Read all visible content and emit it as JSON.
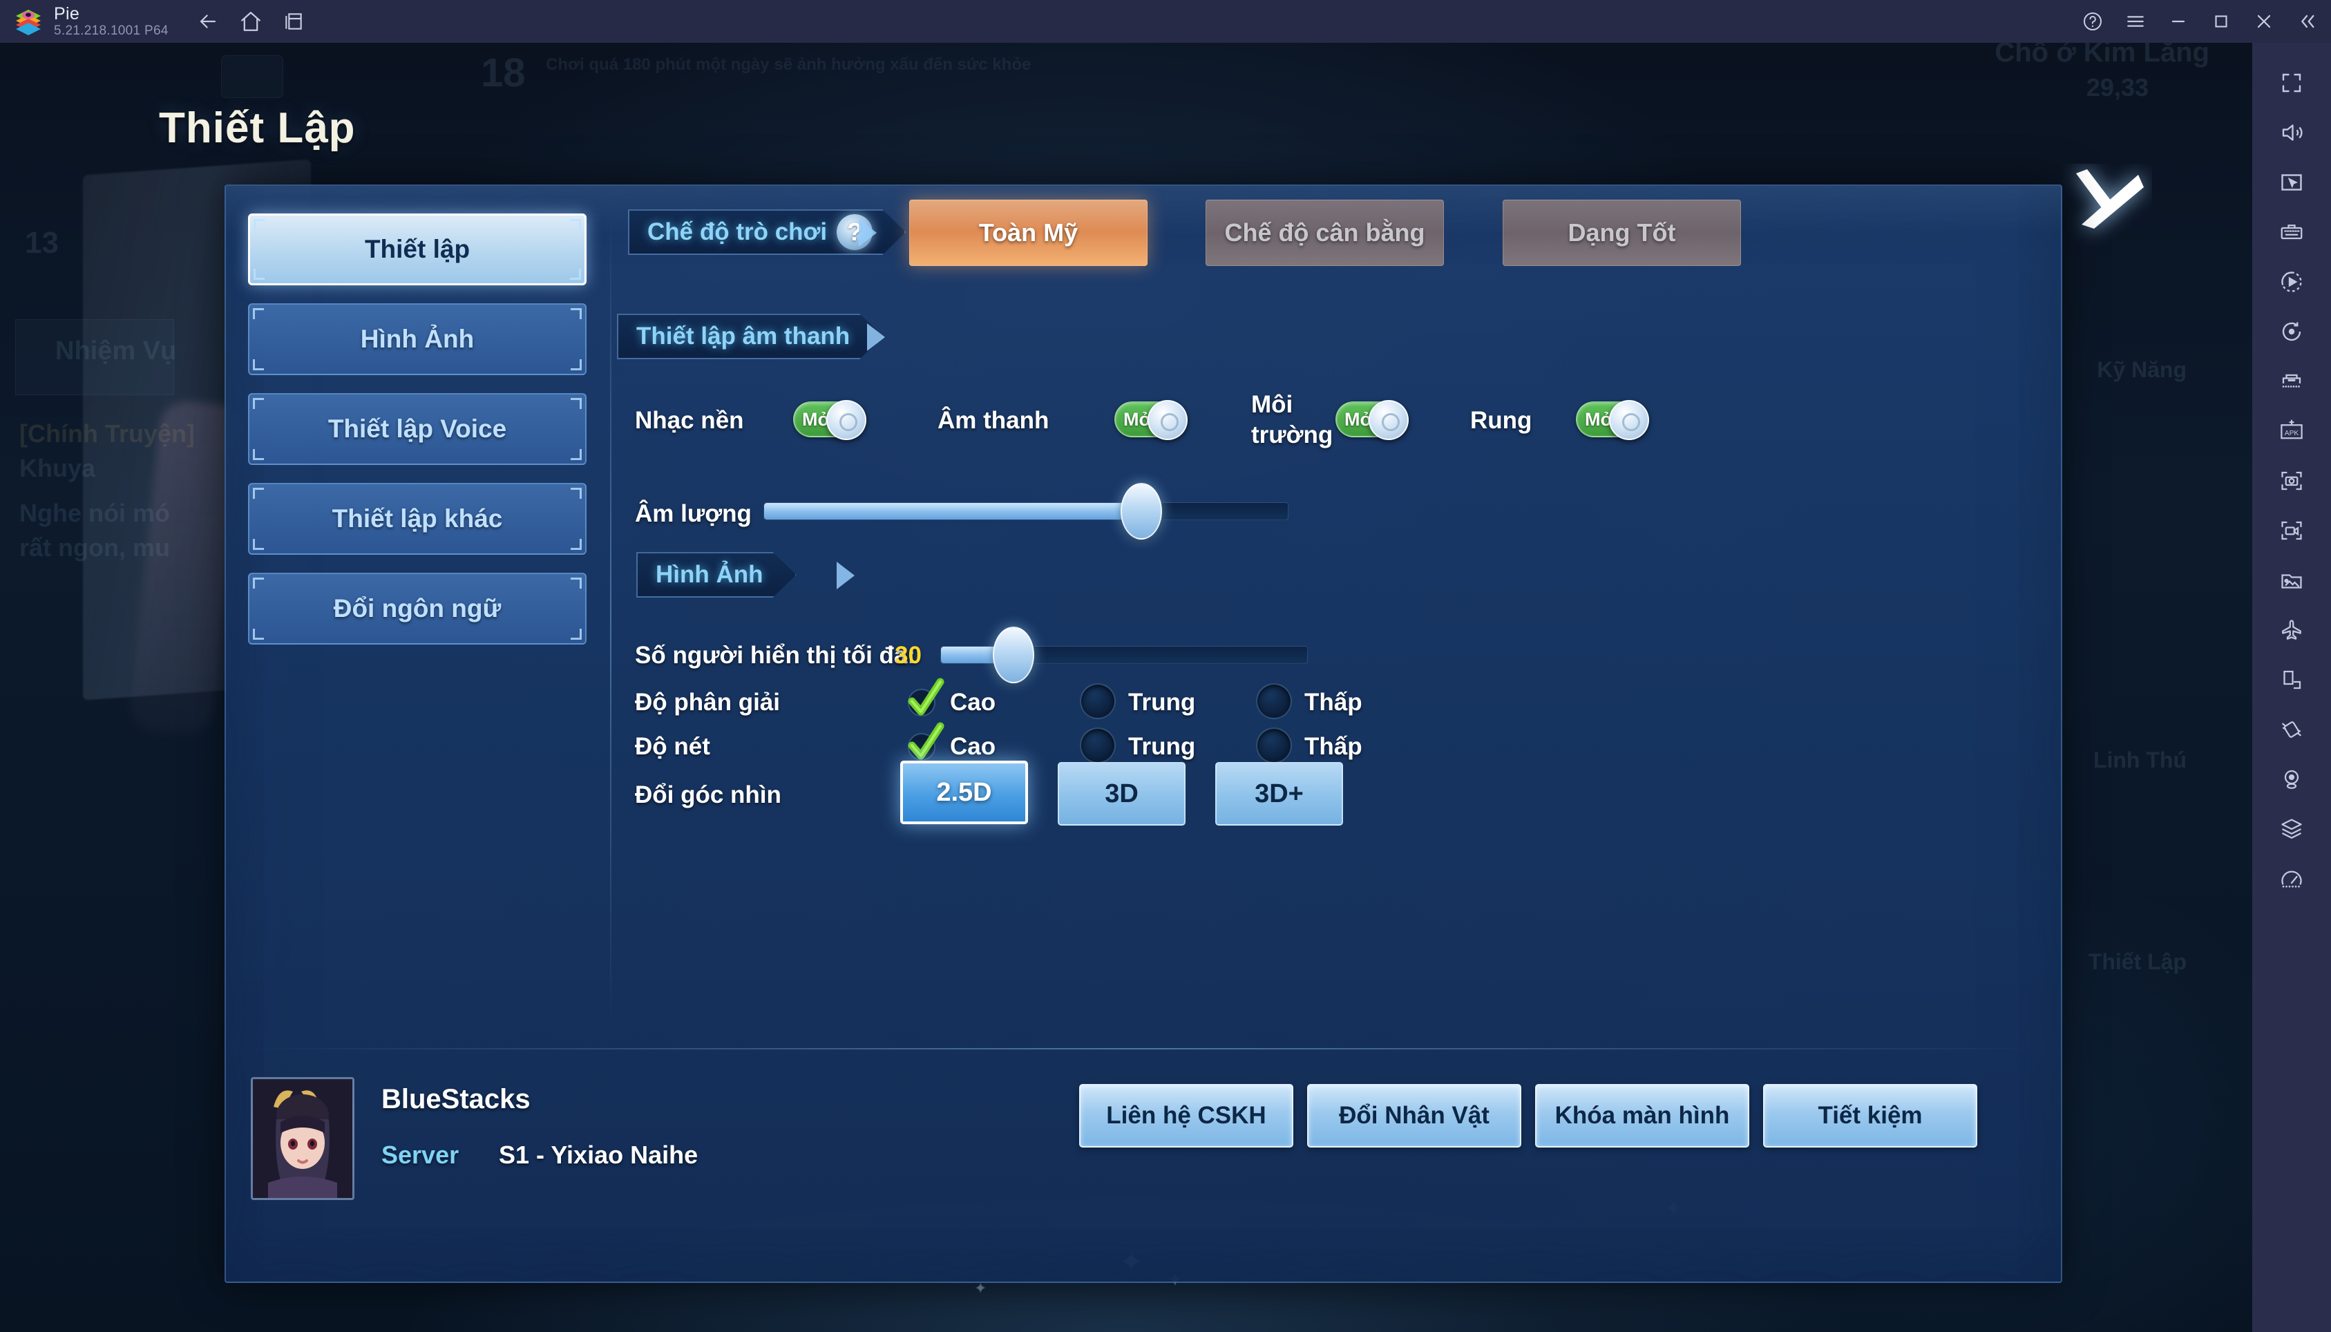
{
  "titlebar": {
    "app_name": "Pie",
    "version": "5.21.218.1001  P64",
    "nav": [
      {
        "name": "back-icon",
        "label": "Back"
      },
      {
        "name": "home-icon",
        "label": "Home"
      },
      {
        "name": "multi-instance-icon",
        "label": "Multi-instance"
      }
    ],
    "right": [
      {
        "name": "help-icon",
        "label": "Help"
      },
      {
        "name": "menu-icon",
        "label": "Menu"
      },
      {
        "name": "minimize-icon",
        "label": "Minimize"
      },
      {
        "name": "maximize-icon",
        "label": "Maximize"
      },
      {
        "name": "close-icon",
        "label": "Close"
      },
      {
        "name": "collapse-rail-icon",
        "label": "Collapse"
      }
    ]
  },
  "background": {
    "level": "13",
    "quest_panel_title": "Nhiệm Vụ",
    "quest_line1": "[Chính Truyện]",
    "quest_line2": "Khuya",
    "quest_line3": "Nghe nói mó",
    "quest_line4": "rất ngon, mu",
    "location": "Chỗ ở Kim Lăng",
    "coords": "29,33",
    "age_rating": "18",
    "health_notice": "Chơi quá 180 phút một ngày sẽ ảnh hưởng xấu đến sức khỏe",
    "right_label_1": "Kỹ Năng",
    "right_label_2": "Linh Thú",
    "right_label_3": "Thiết Lập"
  },
  "page_title": "Thiết Lập",
  "close_button": {
    "name": "close-dialog",
    "label": "X"
  },
  "sidebar": {
    "items": [
      {
        "label": "Thiết lập",
        "active": true
      },
      {
        "label": "Hình Ảnh",
        "active": false
      },
      {
        "label": "Thiết lập Voice",
        "active": false
      },
      {
        "label": "Thiết lập khác",
        "active": false
      },
      {
        "label": "Đổi ngôn ngữ",
        "active": false
      }
    ]
  },
  "sections": {
    "game_mode": {
      "header": "Chế độ trò chơi",
      "help_glyph": "?",
      "options": [
        {
          "label": "Toàn Mỹ",
          "selected": true
        },
        {
          "label": "Chế độ cân bằng",
          "selected": false
        },
        {
          "label": "Dạng Tốt",
          "selected": false
        }
      ]
    },
    "audio": {
      "header": "Thiết lập âm thanh",
      "toggles": [
        {
          "label": "Nhạc nền",
          "state": "Mở",
          "on": true
        },
        {
          "label": "Âm thanh",
          "state": "Mở",
          "on": true
        },
        {
          "label": "Môi trường",
          "state": "Mở",
          "on": true
        },
        {
          "label": "Rung",
          "state": "Mở",
          "on": true
        }
      ],
      "volume": {
        "label": "Âm lượng",
        "percent": 72
      }
    },
    "graphics": {
      "header": "Hình Ảnh",
      "max_players": {
        "label": "Số người hiển thị tối đa:",
        "value": "30",
        "percent": 20
      },
      "resolution": {
        "label": "Độ phân giải",
        "options": [
          {
            "label": "Cao",
            "selected": true
          },
          {
            "label": "Trung",
            "selected": false
          },
          {
            "label": "Thấp",
            "selected": false
          }
        ]
      },
      "sharpness": {
        "label": "Độ nét",
        "options": [
          {
            "label": "Cao",
            "selected": true
          },
          {
            "label": "Trung",
            "selected": false
          },
          {
            "label": "Thấp",
            "selected": false
          }
        ]
      },
      "perspective": {
        "label": "Đổi góc nhìn",
        "options": [
          {
            "label": "2.5D",
            "selected": true
          },
          {
            "label": "3D",
            "selected": false
          },
          {
            "label": "3D+",
            "selected": false
          }
        ]
      }
    }
  },
  "footer": {
    "account_name": "BlueStacks",
    "server_label": "Server",
    "server_value": "S1 - Yixiao Naihe",
    "buttons": [
      {
        "label": "Liên hệ CSKH"
      },
      {
        "label": "Đổi Nhân Vật"
      },
      {
        "label": "Khóa màn hình"
      },
      {
        "label": "Tiết kiệm"
      }
    ]
  },
  "rail": {
    "items": [
      {
        "name": "fullscreen-icon"
      },
      {
        "name": "volume-icon"
      },
      {
        "name": "cursor-mode-icon"
      },
      {
        "name": "keyboard-controls-icon"
      },
      {
        "name": "macro-recorder-icon"
      },
      {
        "name": "rotate-icon"
      },
      {
        "name": "multi-instance-sync-icon"
      },
      {
        "name": "install-apk-icon"
      },
      {
        "name": "screenshot-icon"
      },
      {
        "name": "screen-record-icon"
      },
      {
        "name": "media-manager-icon"
      },
      {
        "name": "airplane-mode-icon"
      },
      {
        "name": "rotate-screen-icon"
      },
      {
        "name": "shake-icon"
      },
      {
        "name": "location-icon"
      },
      {
        "name": "layers-icon"
      },
      {
        "name": "performance-icon"
      }
    ]
  },
  "colors": {
    "accent_orange": "#df8b54",
    "accent_blue": "#8dc0ee",
    "toggle_green": "#4faa4a",
    "highlight_yellow": "#ffd92b",
    "cyan_text": "#8fd4f6"
  }
}
